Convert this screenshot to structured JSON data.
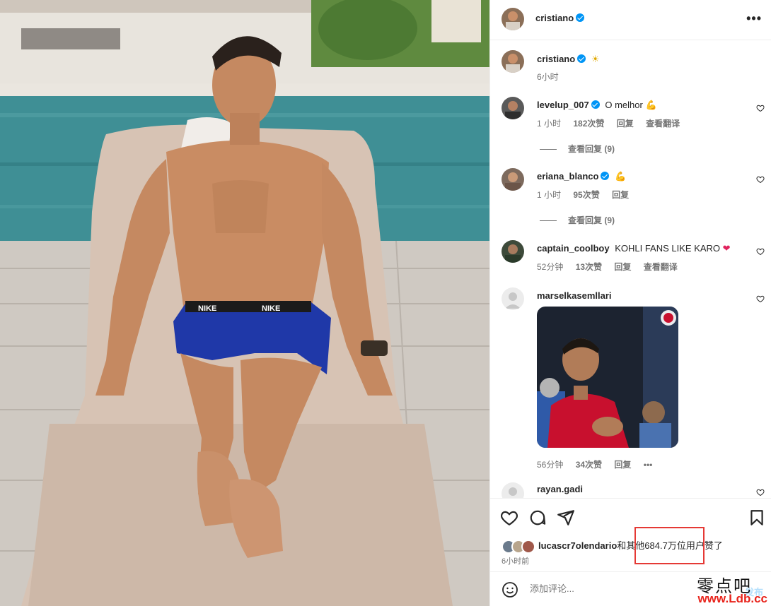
{
  "header": {
    "username": "cristiano",
    "more_label": "•••"
  },
  "caption": {
    "username": "cristiano",
    "emoji": "☀",
    "time": "6小时"
  },
  "comments": [
    {
      "username": "levelup_007",
      "verified": true,
      "text": "O melhor",
      "emoji": "💪",
      "time": "1 小时",
      "likes": "182次赞",
      "reply": "回复",
      "translate": "查看翻译",
      "view_replies": "查看回复 (9)"
    },
    {
      "username": "eriana_blanco",
      "verified": true,
      "text": "",
      "emoji": "💪",
      "time": "1 小时",
      "likes": "95次赞",
      "reply": "回复",
      "view_replies": "查看回复 (9)"
    },
    {
      "username": "captain_coolboy",
      "verified": false,
      "text": "KOHLI FANS LIKE KARO",
      "emoji": "❤",
      "time": "52分钟",
      "likes": "13次赞",
      "reply": "回复",
      "translate": "查看翻译"
    },
    {
      "username": "marselkasemllari",
      "verified": false,
      "text": "",
      "time": "56分钟",
      "likes": "34次赞",
      "reply": "回复",
      "more": "•••"
    },
    {
      "username": "rayan.gadi",
      "verified": false,
      "text": ""
    }
  ],
  "actions": {
    "liked_by": "lucascr7olendario",
    "likes_suffix": "和其他684.7万位用户赞了",
    "posted": "6小时前"
  },
  "add_comment": {
    "placeholder": "添加评论...",
    "post_label": "发布"
  },
  "watermark": {
    "cn": "零点吧",
    "url": "www.Ldb.cc"
  },
  "colors": {
    "verified": "#0095f6",
    "highlight": "#e53935",
    "kit_red": "#c8102e"
  },
  "icons": [
    "heart-icon",
    "comment-icon",
    "share-icon",
    "bookmark-icon",
    "emoji-icon",
    "verified-icon",
    "more-icon"
  ]
}
